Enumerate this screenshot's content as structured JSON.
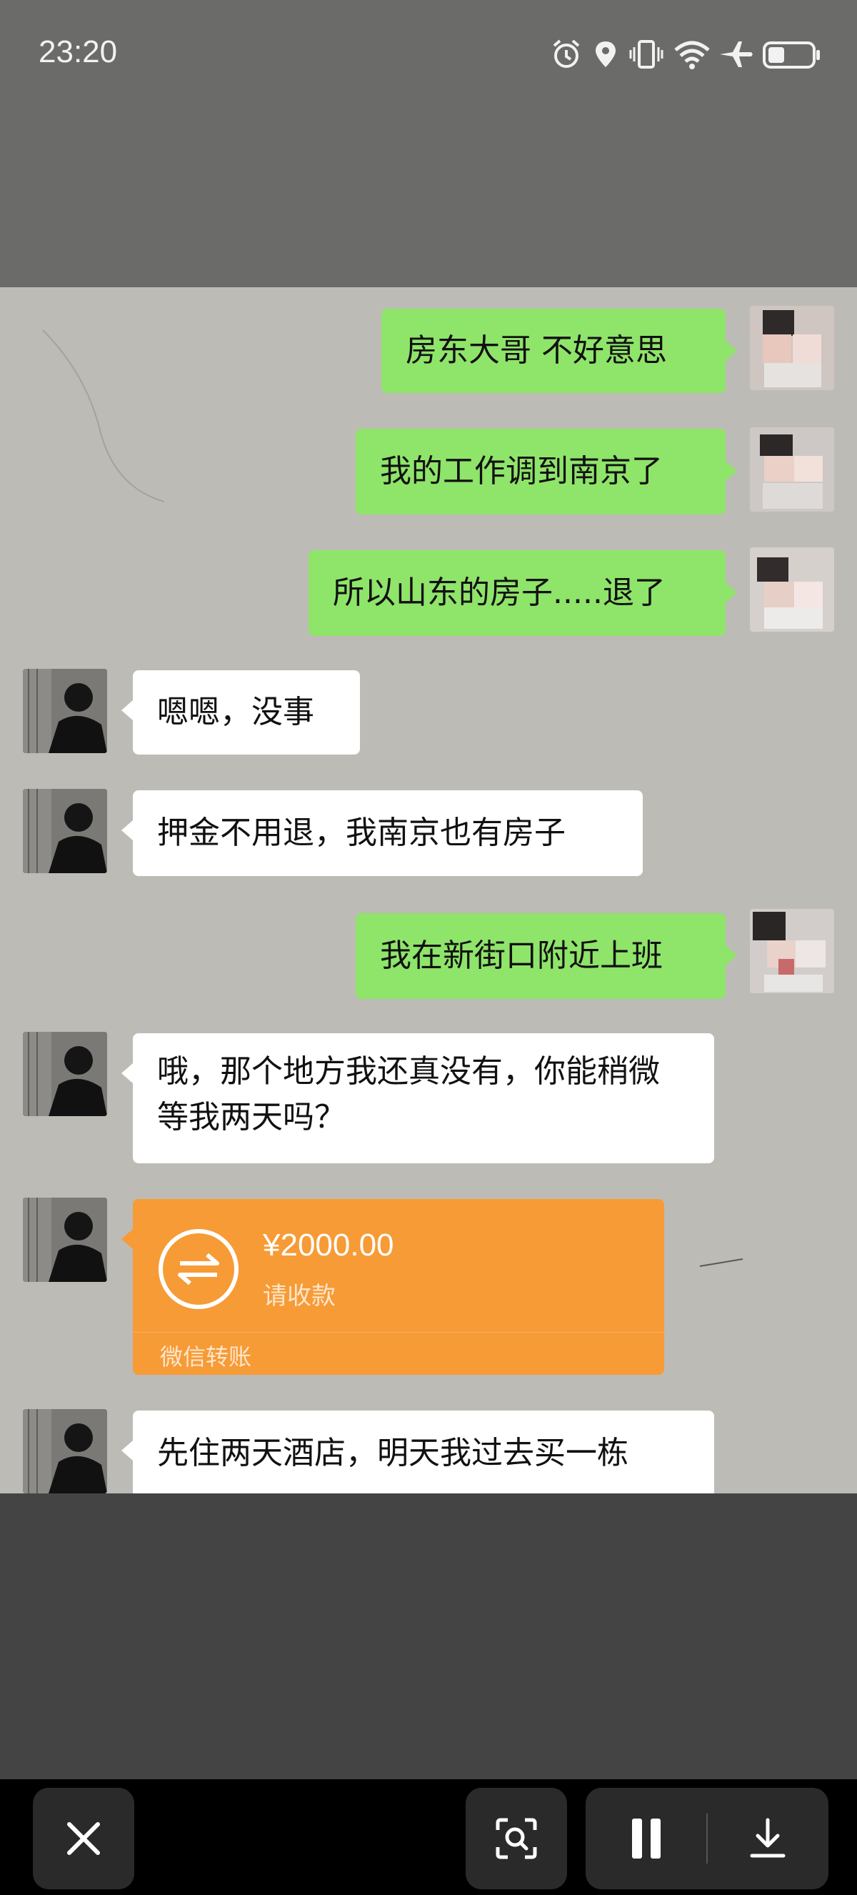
{
  "status_bar": {
    "time": "23:20",
    "icons": [
      "alarm-icon",
      "location-icon",
      "vibrate-icon",
      "wifi-icon",
      "airplane-mode-icon",
      "battery-icon"
    ]
  },
  "chat": {
    "messages": [
      {
        "side": "right",
        "text": "房东大哥 不好意思"
      },
      {
        "side": "right",
        "text": "我的工作调到南京了"
      },
      {
        "side": "right",
        "text": "所以山东的房子.....退了"
      },
      {
        "side": "left",
        "text": "嗯嗯，没事"
      },
      {
        "side": "left",
        "text": "押金不用退，我南京也有房子"
      },
      {
        "side": "right",
        "text": "我在新街口附近上班"
      },
      {
        "side": "left",
        "text": "哦，那个地方我还真没有，你能稍微等我两天吗？"
      },
      {
        "side": "left",
        "type": "transfer"
      },
      {
        "side": "left",
        "text": "先住两天酒店，明天我过去买一栋"
      }
    ],
    "transfer": {
      "amount": "¥2000.00",
      "status": "请收款",
      "footer": "微信转账",
      "color": "#f79b36",
      "icon": "transfer-arrows-icon"
    }
  },
  "controls": {
    "buttons": [
      "close-icon",
      "scan-icon",
      "pause-icon",
      "download-icon"
    ]
  },
  "colors": {
    "sent_bubble": "#8fe46a",
    "received_bubble": "#ffffff",
    "chat_background": "#bdbbb5"
  }
}
